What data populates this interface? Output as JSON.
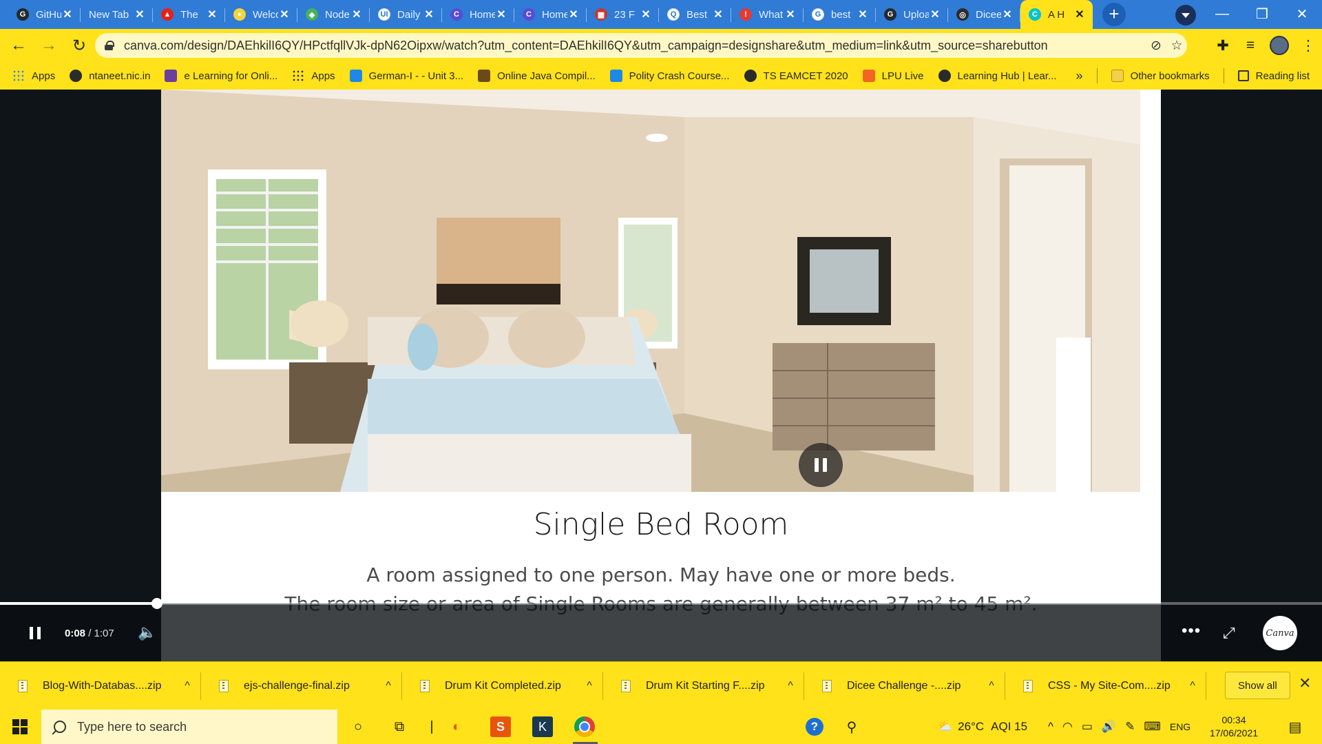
{
  "tabs": [
    {
      "title": "GitHub",
      "icon": "github-icon",
      "color": "#24292e",
      "glyph": "G"
    },
    {
      "title": "New Tab",
      "icon": "",
      "color": "",
      "glyph": ""
    },
    {
      "title": "The",
      "icon": "youtube-red-icon",
      "color": "#e62117",
      "glyph": "▲"
    },
    {
      "title": "Welcome",
      "icon": "badge-icon",
      "color": "#f5d33b",
      "glyph": "●"
    },
    {
      "title": "Node",
      "icon": "node-leaf-icon",
      "color": "#44b35a",
      "glyph": "◆"
    },
    {
      "title": "Daily",
      "icon": "ui-icon",
      "color": "#ffffff",
      "glyph": "UI"
    },
    {
      "title": "Home",
      "icon": "canva-icon",
      "color": "#5a4bd6",
      "glyph": "C"
    },
    {
      "title": "Home",
      "icon": "canva-icon",
      "color": "#5a4bd6",
      "glyph": "C"
    },
    {
      "title": "23 F",
      "icon": "chart-icon",
      "color": "#c9372c",
      "glyph": "▦"
    },
    {
      "title": "Best",
      "icon": "quora-icon",
      "color": "#ffffff",
      "glyph": "Q"
    },
    {
      "title": "What",
      "icon": "alert-icon",
      "color": "#e53935",
      "glyph": "!"
    },
    {
      "title": "best",
      "icon": "google-icon",
      "color": "#ffffff",
      "glyph": "G"
    },
    {
      "title": "Upload",
      "icon": "github-icon",
      "color": "#24292e",
      "glyph": "G"
    },
    {
      "title": "Dicee",
      "icon": "globe-icon",
      "color": "#2b2b2b",
      "glyph": "◎"
    },
    {
      "title": "A H",
      "icon": "canva-icon",
      "color": "#00c4cc",
      "glyph": "C"
    }
  ],
  "address": {
    "url": "canva.com/design/DAEhkilI6QY/HPctfqllVJk-dpN62Oipxw/watch?utm_content=DAEhkilI6QY&utm_campaign=designshare&utm_medium=link&utm_source=sharebutton"
  },
  "bookmarks": [
    {
      "label": "Apps",
      "icon": "apps-grid-icon",
      "color": "#4285f4"
    },
    {
      "label": "ntaneet.nic.in",
      "icon": "globe-icon",
      "color": "#2b2b2b"
    },
    {
      "label": "e Learning for Onli...",
      "icon": "e-learning-icon",
      "color": "#6b3fa0"
    },
    {
      "label": "Apps",
      "icon": "apps-grid-icon",
      "color": "#2b2b2b"
    },
    {
      "label": "German-I - - Unit 3...",
      "icon": "s-icon",
      "color": "#1e88e5"
    },
    {
      "label": "Online Java Compil...",
      "icon": "java-cup-icon",
      "color": "#6b4a1a"
    },
    {
      "label": "Polity Crash Course...",
      "icon": "bookmark-blue-icon",
      "color": "#1e88e5"
    },
    {
      "label": "TS EAMCET 2020",
      "icon": "globe-icon",
      "color": "#2b2b2b"
    },
    {
      "label": "LPU Live",
      "icon": "lpu-icon",
      "color": "#f26522"
    },
    {
      "label": "Learning Hub | Lear...",
      "icon": "globe-icon",
      "color": "#2b2b2b"
    }
  ],
  "bookmarks_right": {
    "more": "»",
    "other": "Other bookmarks",
    "reading": "Reading list"
  },
  "slide": {
    "title": "Single Bed Room",
    "line1": "A room assigned to one person. May have one or more beds.",
    "line2": "The room size or area of Single Rooms are generally between 37 m² to 45 m²."
  },
  "player": {
    "current": "0:08",
    "total": "/ 1:07",
    "progress": 0.119,
    "logo": "Canva"
  },
  "downloads": [
    "Blog-With-Databas....zip",
    "ejs-challenge-final.zip",
    "Drum Kit Completed.zip",
    "Drum Kit Starting F....zip",
    "Dicee Challenge -....zip",
    "CSS - My Site-Com....zip"
  ],
  "downloads_show_all": "Show all",
  "taskbar": {
    "search_placeholder": "Type here to search",
    "weather": "26°C",
    "aqi": "AQI 15",
    "lang": "ENG",
    "time": "00:34",
    "date": "17/06/2021"
  },
  "colors": {
    "theme_yellow": "#ffe21a",
    "tab_blue": "#2f7bd6",
    "viewer_dark": "#0f1418"
  }
}
